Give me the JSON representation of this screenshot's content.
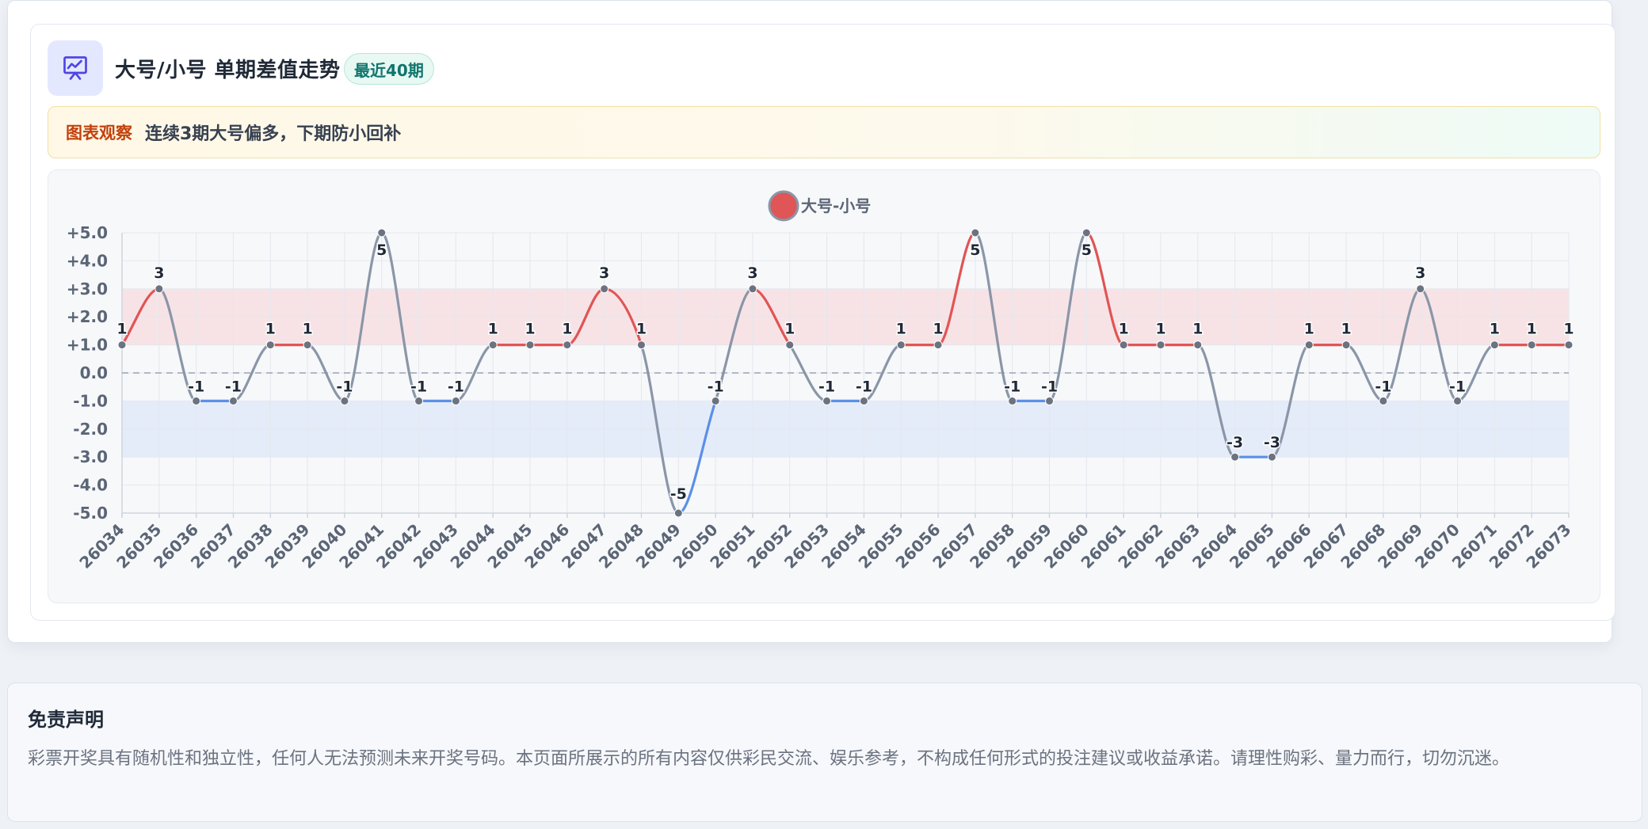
{
  "section": {
    "title": "大号/小号 单期差值走势",
    "badge": "最近40期",
    "observe_label": "图表观察",
    "observe_text": "连续3期大号偏多，下期防小回补"
  },
  "disclaimer": {
    "title": "免责声明",
    "text": "彩票开奖具有随机性和独立性，任何人无法预测未来开奖号码。本页面所展示的所有内容仅供彩民交流、娱乐参考，不构成任何形式的投注建议或收益承诺。请理性购彩、量力而行，切勿沉迷。"
  },
  "colors": {
    "positive": "#e05555",
    "negative": "#5b8fe8",
    "neutral": "#8a96a8",
    "band_positive": "#f7e3e6",
    "band_negative": "#e5ecf9"
  },
  "chart_data": {
    "type": "line",
    "title": "",
    "xlabel": "",
    "ylabel": "",
    "ylim": [
      -5,
      5
    ],
    "yticks": [
      5,
      4,
      3,
      2,
      1,
      0,
      -1,
      -2,
      -3,
      -4,
      -5
    ],
    "ytick_labels": [
      "+5.0",
      "+4.0",
      "+3.0",
      "+2.0",
      "+1.0",
      "0.0",
      "-1.0",
      "-2.0",
      "-3.0",
      "-4.0",
      "-5.0"
    ],
    "legend": {
      "position": "top-center"
    },
    "grid": true,
    "bands": [
      {
        "from": 1,
        "to": 3,
        "kind": "positive"
      },
      {
        "from": -3,
        "to": -1,
        "kind": "negative"
      }
    ],
    "zero_line": "dashed",
    "categories": [
      "26034",
      "26035",
      "26036",
      "26037",
      "26038",
      "26039",
      "26040",
      "26041",
      "26042",
      "26043",
      "26044",
      "26045",
      "26046",
      "26047",
      "26048",
      "26049",
      "26050",
      "26051",
      "26052",
      "26053",
      "26054",
      "26055",
      "26056",
      "26057",
      "26058",
      "26059",
      "26060",
      "26061",
      "26062",
      "26063",
      "26064",
      "26065",
      "26066",
      "26067",
      "26068",
      "26069",
      "26070",
      "26071",
      "26072",
      "26073"
    ],
    "series": [
      {
        "name": "大号-小号",
        "values": [
          1,
          3,
          -1,
          -1,
          1,
          1,
          -1,
          5,
          -1,
          -1,
          1,
          1,
          1,
          3,
          1,
          -5,
          -1,
          3,
          1,
          -1,
          -1,
          1,
          1,
          5,
          -1,
          -1,
          5,
          1,
          1,
          1,
          -3,
          -3,
          1,
          1,
          -1,
          3,
          -1,
          1,
          1,
          1
        ]
      }
    ]
  }
}
